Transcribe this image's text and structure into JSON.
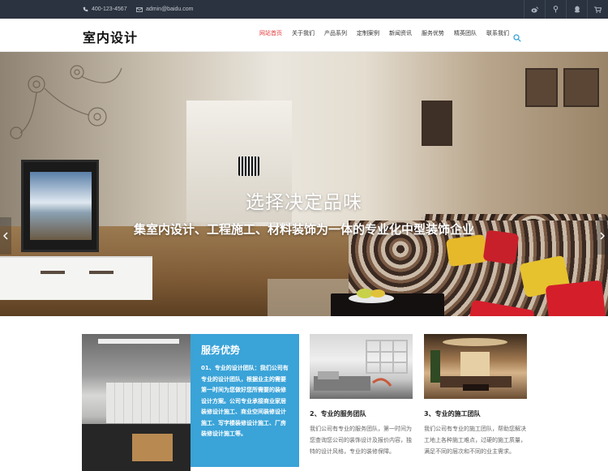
{
  "topbar": {
    "phone": "400-123-4567",
    "email": "admin@baidu.com",
    "social": [
      "weibo-icon",
      "qzone-icon",
      "qq-icon",
      "cart-icon"
    ]
  },
  "header": {
    "logo": "室内设计",
    "nav": [
      {
        "label": "网站首页",
        "active": true
      },
      {
        "label": "关于我们",
        "active": false
      },
      {
        "label": "产品系列",
        "active": false
      },
      {
        "label": "定制案例",
        "active": false
      },
      {
        "label": "新闻资讯",
        "active": false
      },
      {
        "label": "服务优势",
        "active": false
      },
      {
        "label": "精英团队",
        "active": false
      },
      {
        "label": "联系我们",
        "active": false
      }
    ],
    "accent": "#e43a3a"
  },
  "banner": {
    "title": "选择决定品味",
    "subtitle": "集室内设计、工程施工、材料装饰为一体的专业化中型装饰企业"
  },
  "services": {
    "title": "服务优势",
    "text": "01、专业的设计团队：我们公司有专业的设计团队，根据业主的需要第一时间为您做好您所需要的装修设计方案。公司专业承接商业家居装修设计施工、商业空间装修设计施工、写字楼装修设计施工、厂房装修设计施工等。",
    "accent": "#3aa3d8",
    "cards": [
      {
        "title": "2、专业的服务团队",
        "text": "我们公司有专业的服务团队，第一时间为您查询您公司的装饰设计及报价内容，独特的设计风格，专业的装修保障。"
      },
      {
        "title": "3、专业的施工团队",
        "text": "我们公司有专业的施工团队，帮助您解决工地上各种施工难点，过硬的施工质量，满足不同的层次和不同的业主需求。"
      }
    ]
  }
}
